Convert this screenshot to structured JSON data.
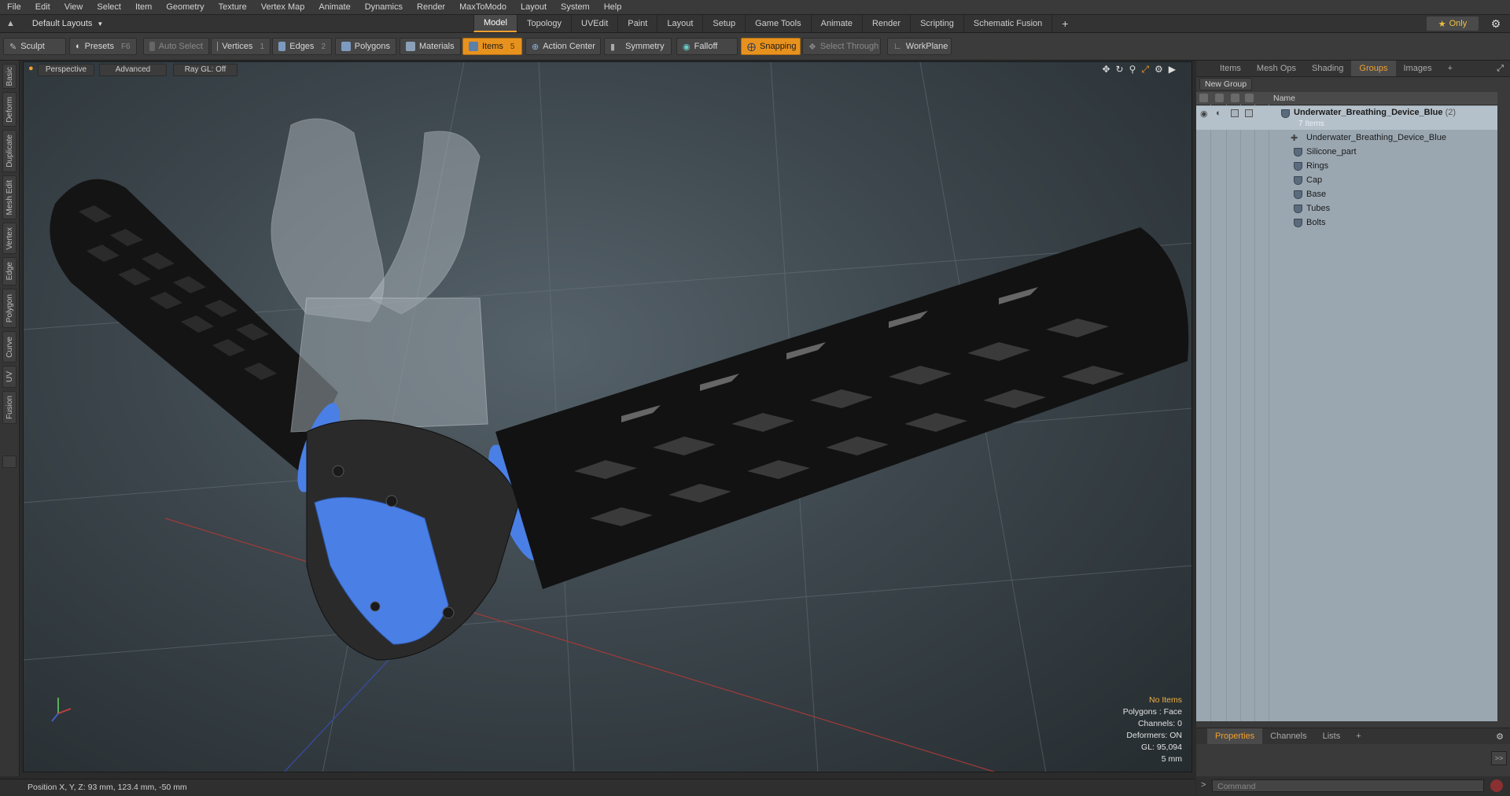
{
  "menu": [
    "File",
    "Edit",
    "View",
    "Select",
    "Item",
    "Geometry",
    "Texture",
    "Vertex Map",
    "Animate",
    "Dynamics",
    "Render",
    "MaxToModo",
    "Layout",
    "System",
    "Help"
  ],
  "layout_dropdown": "Default Layouts",
  "layout_tabs": [
    {
      "label": "Model",
      "active": true
    },
    {
      "label": "Topology"
    },
    {
      "label": "UVEdit"
    },
    {
      "label": "Paint"
    },
    {
      "label": "Layout"
    },
    {
      "label": "Setup"
    },
    {
      "label": "Game Tools"
    },
    {
      "label": "Animate"
    },
    {
      "label": "Render"
    },
    {
      "label": "Scripting"
    },
    {
      "label": "Schematic Fusion"
    }
  ],
  "only_label": "Only",
  "toolbar": {
    "sculpt": "Sculpt",
    "presets": "Presets",
    "presets_key": "F6",
    "auto_select": "Auto Select",
    "vertices": "Vertices",
    "vertices_key": "1",
    "edges": "Edges",
    "edges_key": "2",
    "polygons": "Polygons",
    "materials": "Materials",
    "items": "Items",
    "items_key": "5",
    "action_center": "Action Center",
    "symmetry": "Symmetry",
    "falloff": "Falloff",
    "snapping": "Snapping",
    "select_through": "Select Through",
    "workplane": "WorkPlane"
  },
  "left_tabs": [
    "Basic",
    "Deform",
    "Duplicate",
    "Mesh Edit",
    "Vertex",
    "Edge",
    "Polygon",
    "Curve",
    "UV",
    "Fusion"
  ],
  "viewport": {
    "perspective": "Perspective",
    "advanced": "Advanced",
    "raygl": "Ray GL: Off",
    "hud": {
      "items": "No Items",
      "polygons": "Polygons : Face",
      "channels": "Channels: 0",
      "deformers": "Deformers: ON",
      "gl": "GL: 95,094",
      "scale": "5 mm"
    }
  },
  "status": "Position X, Y, Z:  93 mm, 123.4 mm, -50 mm",
  "right_tabs": [
    {
      "label": "Items"
    },
    {
      "label": "Mesh Ops"
    },
    {
      "label": "Shading"
    },
    {
      "label": "Groups",
      "active": true
    },
    {
      "label": "Images"
    }
  ],
  "new_group": "New Group",
  "column_name": "Name",
  "group": {
    "name": "Underwater_Breathing_Device_Blue",
    "count": "(2)",
    "items_count": "7 Items"
  },
  "group_items": [
    "Underwater_Breathing_Device_Blue",
    "Silicone_part",
    "Rings",
    "Cap",
    "Base",
    "Tubes",
    "Bolts"
  ],
  "bottom_tabs": [
    {
      "label": "Properties",
      "active": true
    },
    {
      "label": "Channels"
    },
    {
      "label": "Lists"
    }
  ],
  "command_placeholder": "Command",
  "colors": {
    "accent": "#e8921e",
    "mesh_blue": "#4a7fe6",
    "tube_black": "#141414",
    "viewport_bg": "#3c464c"
  }
}
